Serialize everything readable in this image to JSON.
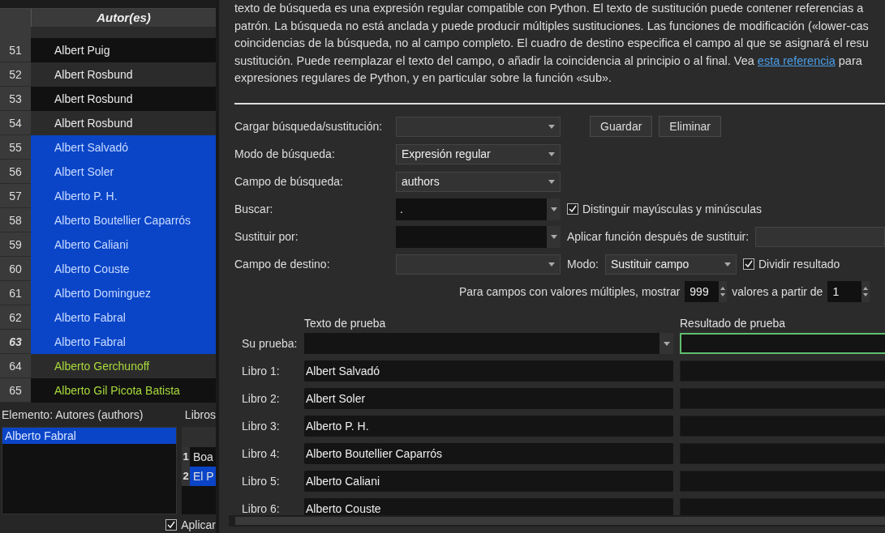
{
  "book_list": {
    "header": "Autor(es)",
    "rows": [
      {
        "number": "51",
        "author": "Albert Puig",
        "selected": false,
        "current": false,
        "color": "#e8e8e8"
      },
      {
        "number": "52",
        "author": "Albert Rosbund",
        "selected": false,
        "current": false,
        "color": "#e8e8e8"
      },
      {
        "number": "53",
        "author": "Albert Rosbund",
        "selected": false,
        "current": false,
        "color": "#e8e8e8"
      },
      {
        "number": "54",
        "author": "Albert Rosbund",
        "selected": false,
        "current": false,
        "color": "#e8e8e8"
      },
      {
        "number": "55",
        "author": "Albert Salvadó",
        "selected": true,
        "current": false
      },
      {
        "number": "56",
        "author": "Albert Soler",
        "selected": true,
        "current": false
      },
      {
        "number": "57",
        "author": "Alberto P. H.",
        "selected": true,
        "current": false
      },
      {
        "number": "58",
        "author": "Alberto Boutellier Caparrós",
        "selected": true,
        "current": false
      },
      {
        "number": "59",
        "author": "Alberto Caliani",
        "selected": true,
        "current": false
      },
      {
        "number": "60",
        "author": "Alberto Couste",
        "selected": true,
        "current": false
      },
      {
        "number": "61",
        "author": "Alberto Dominguez",
        "selected": true,
        "current": false
      },
      {
        "number": "62",
        "author": "Alberto Fabral",
        "selected": true,
        "current": false
      },
      {
        "number": "63",
        "author": "Alberto Fabral",
        "selected": true,
        "current": true
      },
      {
        "number": "64",
        "author": "Alberto Gerchunoff",
        "selected": false,
        "current": false,
        "color": "#a8d83c"
      },
      {
        "number": "65",
        "author": "Alberto Gil Picota Batista",
        "selected": false,
        "current": false,
        "color": "#a8d83c"
      }
    ]
  },
  "element": {
    "label": "Elemento: Autores (authors)",
    "items": [
      {
        "text": "Alberto Fabral",
        "selected": true
      }
    ]
  },
  "books": {
    "label": "Libros",
    "rows": [
      {
        "number": "1",
        "title": "Boa",
        "selected": false
      },
      {
        "number": "2",
        "title": "El P",
        "selected": true
      }
    ]
  },
  "apply": {
    "label": "Aplicar",
    "checked": true
  },
  "help_lines": [
    {
      "text": "texto de búsqueda es una expresión regular compatible con Python. El texto de sustitución puede contener referencias a"
    },
    {
      "text": "patrón. La búsqueda no está anclada y puede producir múltiples sustituciones. Las funciones de modificación («lower-cas"
    },
    {
      "text": "coincidencias de la búsqueda, no al campo completo. El cuadro de destino especifica el campo al que se asignará el resu"
    },
    {
      "text": "sustitución. Puede reemplazar el texto del campo, o añadir la coincidencia al principio o al final. Vea ",
      "link": "esta referencia",
      "after": " para"
    },
    {
      "text": "expresiones regulares de Python, y en particular sobre la función «sub»."
    }
  ],
  "load": {
    "label": "Cargar búsqueda/sustitución:",
    "buttons": [
      "Guardar",
      "Eliminar"
    ]
  },
  "search_mode": {
    "label": "Modo de búsqueda:",
    "value": "Expresión regular"
  },
  "search_field": {
    "label": "Campo de búsqueda:",
    "value": "authors"
  },
  "find": {
    "label": "Buscar:",
    "value": ".",
    "case_sensitive": {
      "label": "Distinguir mayúsculas y minúsculas",
      "checked": true
    }
  },
  "replace": {
    "label": "Sustituir por:",
    "function_label": "Aplicar función después de sustituir:"
  },
  "destination": {
    "label": "Campo de destino:",
    "mode_label": "Modo:",
    "mode": "Sustituir campo",
    "split": {
      "label": "Dividir resultado",
      "checked": true
    }
  },
  "multiple": {
    "label_before": "Para campos con valores múltiples, mostrar",
    "count": "999",
    "label_after": "valores a partir de",
    "start": "1"
  },
  "test": {
    "input_header": "Texto de prueba",
    "result_header": "Resultado de prueba",
    "your_test_label": "Su prueba:",
    "result_focused": true,
    "books": [
      {
        "label": "Libro 1:",
        "text": "Albert Salvadó"
      },
      {
        "label": "Libro 2:",
        "text": "Albert Soler"
      },
      {
        "label": "Libro 3:",
        "text": "Alberto P. H."
      },
      {
        "label": "Libro 4:",
        "text": "Alberto Boutellier Caparrós"
      },
      {
        "label": "Libro 5:",
        "text": "Alberto Caliani"
      },
      {
        "label": "Libro 6:",
        "text": "Alberto Couste"
      }
    ]
  }
}
